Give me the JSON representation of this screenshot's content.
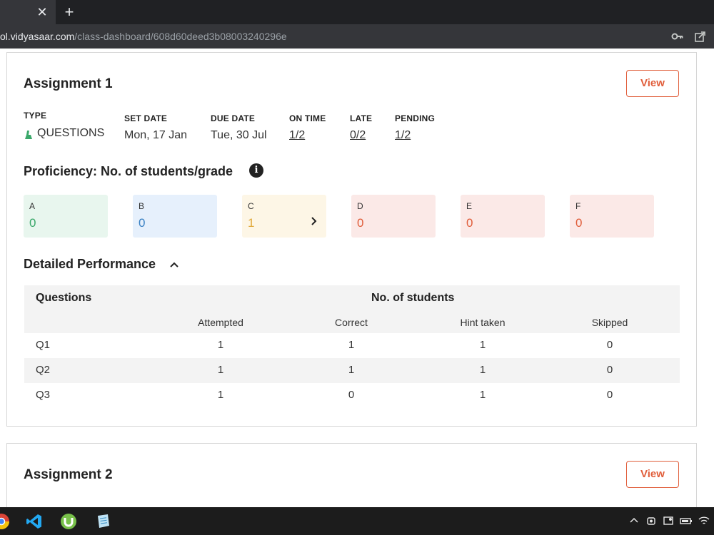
{
  "browser": {
    "tab_close": "✕",
    "new_tab": "+",
    "url_host": "ol.vidyasaar.com",
    "url_path": "/class-dashboard/608d60deed3b08003240296e"
  },
  "assignments": [
    {
      "title": "Assignment 1",
      "view_label": "View",
      "meta": {
        "type_label": "TYPE",
        "type_value": "QUESTIONS",
        "set_date_label": "SET DATE",
        "set_date_value": "Mon, 17 Jan",
        "due_date_label": "DUE DATE",
        "due_date_value": "Tue, 30 Jul",
        "on_time_label": "ON TIME",
        "on_time_value": "1/2",
        "late_label": "LATE",
        "late_value": "0/2",
        "pending_label": "PENDING",
        "pending_value": "1/2"
      },
      "proficiency_title": "Proficiency: No. of students/grade",
      "info_icon": "i",
      "grades": [
        {
          "label": "A",
          "count": "0",
          "bg": "#e8f6ee",
          "color": "#3aa86a"
        },
        {
          "label": "B",
          "count": "0",
          "bg": "#e6f0fc",
          "color": "#3b82c4"
        },
        {
          "label": "C",
          "count": "1",
          "bg": "#fdf6e6",
          "color": "#e0a93a",
          "arrow": "›"
        },
        {
          "label": "D",
          "count": "0",
          "bg": "#fbe9e7",
          "color": "#e05d3a"
        },
        {
          "label": "E",
          "count": "0",
          "bg": "#fbe9e7",
          "color": "#e05d3a"
        },
        {
          "label": "F",
          "count": "0",
          "bg": "#fbe9e7",
          "color": "#e05d3a"
        }
      ],
      "detailed_title": "Detailed Performance",
      "table": {
        "col_questions": "Questions",
        "col_group": "No. of students",
        "sub_headers": [
          "Attempted",
          "Correct",
          "Hint taken",
          "Skipped"
        ],
        "rows": [
          {
            "q": "Q1",
            "values": [
              "1",
              "1",
              "1",
              "0"
            ]
          },
          {
            "q": "Q2",
            "values": [
              "1",
              "1",
              "1",
              "0"
            ]
          },
          {
            "q": "Q3",
            "values": [
              "1",
              "0",
              "1",
              "0"
            ]
          }
        ]
      }
    },
    {
      "title": "Assignment 2",
      "view_label": "View"
    }
  ]
}
